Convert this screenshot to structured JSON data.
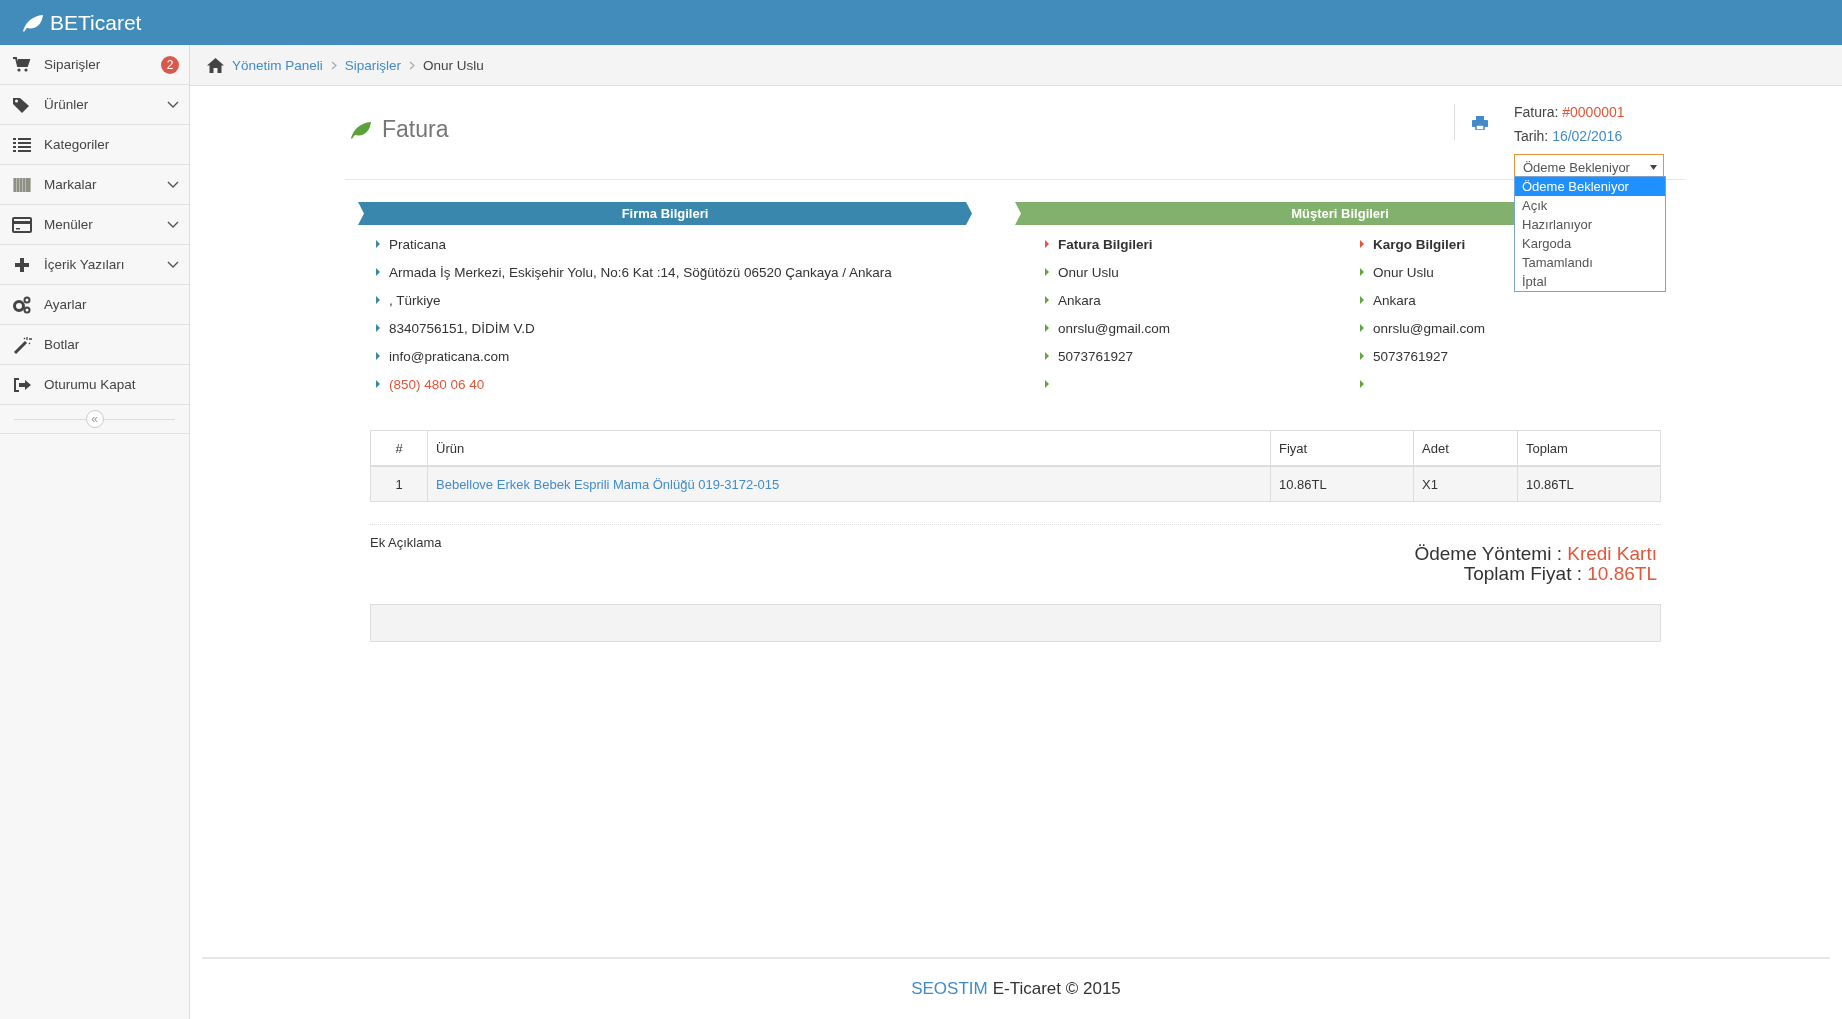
{
  "app": {
    "logo": "BETicaret"
  },
  "sidebar": {
    "items": [
      {
        "kind": "cart",
        "label": "Siparişler",
        "badge": "2",
        "expandable": false
      },
      {
        "kind": "tags",
        "label": "Ürünler",
        "expandable": true
      },
      {
        "kind": "list",
        "label": "Kategoriler",
        "expandable": false
      },
      {
        "kind": "barcode",
        "label": "Markalar",
        "expandable": true
      },
      {
        "kind": "card",
        "label": "Menüler",
        "expandable": true
      },
      {
        "kind": "plus",
        "label": "İçerik Yazıları",
        "expandable": true
      },
      {
        "kind": "gears",
        "label": "Ayarlar",
        "expandable": false
      },
      {
        "kind": "wand",
        "label": "Botlar",
        "expandable": false
      },
      {
        "kind": "signout",
        "label": "Oturumu Kapat",
        "expandable": false
      }
    ],
    "collapse_button": "«"
  },
  "breadcrumb": [
    {
      "label": "Yönetim Paneli",
      "current": false
    },
    {
      "label": "Siparişler",
      "current": false
    },
    {
      "label": "Onur Uslu",
      "current": true
    }
  ],
  "invoice": {
    "title": "Fatura",
    "number_label": "Fatura:",
    "number": "#0000001",
    "date_label": "Tarih:",
    "date": "16/02/2016",
    "status_select": {
      "value": "Ödeme Bekleniyor",
      "expanded": true,
      "options": [
        {
          "label": "Ödeme Bekleniyor",
          "selected": true
        },
        {
          "label": "Açık",
          "selected": false
        },
        {
          "label": "Hazırlanıyor",
          "selected": false
        },
        {
          "label": "Kargoda",
          "selected": false
        },
        {
          "label": "Tamamlandı",
          "selected": false
        },
        {
          "label": "İptal",
          "selected": false
        }
      ]
    }
  },
  "company": {
    "heading": "Firma Bilgileri",
    "lines": [
      {
        "text": "Praticana",
        "highlight": false
      },
      {
        "text": "Armada İş Merkezi, Eskişehir Yolu, No:6 Kat :14, Söğütözü 06520 Çankaya / Ankara",
        "highlight": false
      },
      {
        "text": ", Türkiye",
        "highlight": false
      },
      {
        "text": "8340756151, DİDİM V.D",
        "highlight": false
      },
      {
        "text": "info@praticana.com",
        "highlight": false
      },
      {
        "text": "(850) 480 06 40",
        "highlight": true
      }
    ]
  },
  "customer": {
    "heading": "Müşteri Bilgileri",
    "columns": [
      {
        "heading": "Fatura Bilgileri",
        "lines": [
          {
            "kind": "text",
            "text": "Onur Uslu"
          },
          {
            "kind": "text",
            "text": "Ankara"
          },
          {
            "kind": "text",
            "text": "onrslu@gmail.com"
          },
          {
            "kind": "text",
            "text": "5073761927"
          },
          {
            "kind": "blank"
          }
        ]
      },
      {
        "heading": "Kargo Bilgileri",
        "lines": [
          {
            "kind": "text",
            "text": "Onur Uslu"
          },
          {
            "kind": "text",
            "text": "Ankara"
          },
          {
            "kind": "text",
            "text": "onrslu@gmail.com"
          },
          {
            "kind": "text",
            "text": "5073761927"
          },
          {
            "kind": "blank"
          }
        ]
      }
    ]
  },
  "table": {
    "columns": [
      "#",
      "Ürün",
      "Fiyat",
      "Adet",
      "Toplam"
    ],
    "rows": [
      {
        "cells": [
          "1",
          "Bebellove Erkek Bebek Esprili Mama Önlüğü 019-3172-015",
          "10.86TL",
          "X1",
          "10.86TL"
        ]
      }
    ]
  },
  "note": {
    "label": "Ek Açıklama"
  },
  "summary": [
    {
      "label": "Ödeme Yöntemi :",
      "value": "Kredi Kartı"
    },
    {
      "label": "Toplam Fiyat :",
      "value": "10.86TL"
    }
  ],
  "footer": {
    "brand": "SEOSTIM",
    "text": "E-Ticaret © 2015"
  }
}
